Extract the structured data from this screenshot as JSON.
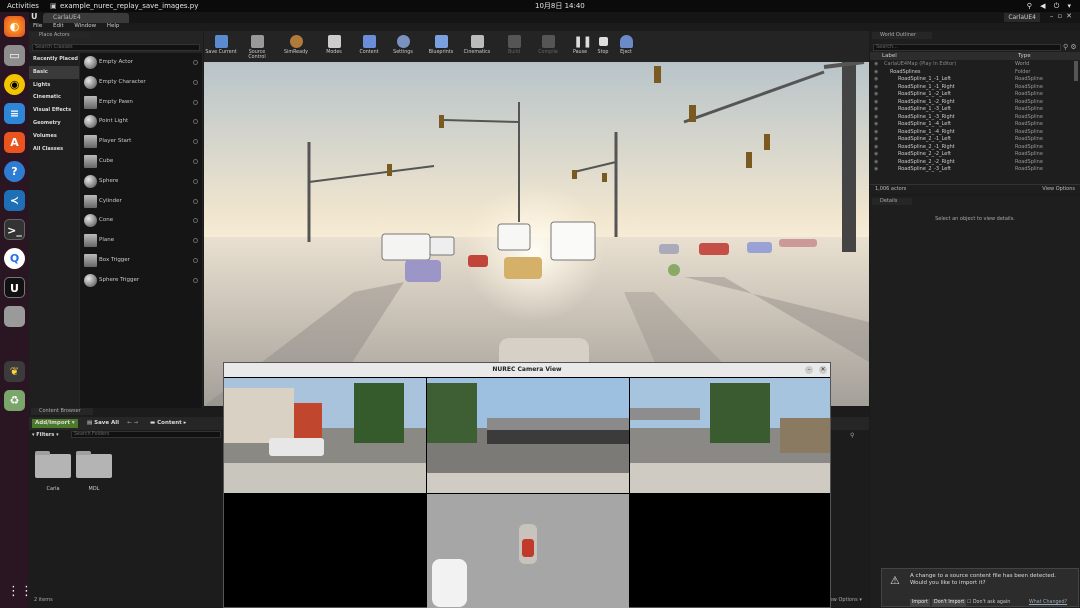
{
  "topbar": {
    "activities": "Activities",
    "app_title": "example_nurec_replay_save_images.py",
    "clock": "10月8日 14:40"
  },
  "dock": {
    "icons": [
      "firefox-icon",
      "files-icon",
      "rhythmbox-icon",
      "writer-icon",
      "software-icon",
      "help-icon",
      "vscode-icon",
      "terminal-icon",
      "qv2ray-icon",
      "unreal-icon",
      "blank-icon",
      "python-icon",
      "trash-icon"
    ],
    "apps_grid": "⋮⋮⋮"
  },
  "editor": {
    "tab_label": "CarlaUE4",
    "project": "CarlaUE4",
    "menu": [
      "File",
      "Edit",
      "Window",
      "Help"
    ],
    "modes_tab": "Place Actors",
    "search_placeholder": "Search Classes",
    "categories": [
      "Recently Placed",
      "Basic",
      "Lights",
      "Cinematic",
      "Visual Effects",
      "Geometry",
      "Volumes",
      "All Classes"
    ],
    "items": [
      "Empty Actor",
      "Empty Character",
      "Empty Pawn",
      "Point Light",
      "Player Start",
      "Cube",
      "Sphere",
      "Cylinder",
      "Cone",
      "Plane",
      "Box Trigger",
      "Sphere Trigger"
    ],
    "toolbar": [
      "Save Current",
      "Source Control",
      "SimReady",
      "Modes",
      "Content",
      "Settings",
      "Blueprints",
      "Cinematics",
      "Build",
      "Compile",
      "Pause",
      "Stop",
      "Eject"
    ]
  },
  "outliner": {
    "tab": "World Outliner",
    "search_placeholder": "Search...",
    "col_label": "Label",
    "col_type": "Type",
    "rows": [
      {
        "label": "CarlaUE4Map (Play In Editor)",
        "type": "World"
      },
      {
        "label": "RoadSplines",
        "type": "Folder"
      },
      {
        "label": "RoadSpline_1_-1_Left",
        "type": "RoadSpline"
      },
      {
        "label": "RoadSpline_1_-1_Right",
        "type": "RoadSpline"
      },
      {
        "label": "RoadSpline_1_-2_Left",
        "type": "RoadSpline"
      },
      {
        "label": "RoadSpline_1_-2_Right",
        "type": "RoadSpline"
      },
      {
        "label": "RoadSpline_1_-3_Left",
        "type": "RoadSpline"
      },
      {
        "label": "RoadSpline_1_-3_Right",
        "type": "RoadSpline"
      },
      {
        "label": "RoadSpline_1_-4_Left",
        "type": "RoadSpline"
      },
      {
        "label": "RoadSpline_1_-4_Right",
        "type": "RoadSpline"
      },
      {
        "label": "RoadSpline_2_-1_Left",
        "type": "RoadSpline"
      },
      {
        "label": "RoadSpline_2_-1_Right",
        "type": "RoadSpline"
      },
      {
        "label": "RoadSpline_2_-2_Left",
        "type": "RoadSpline"
      },
      {
        "label": "RoadSpline_2_-2_Right",
        "type": "RoadSpline"
      },
      {
        "label": "RoadSpline_2_-3_Left",
        "type": "RoadSpline"
      }
    ],
    "count": "1,006 actors",
    "view_options": "View Options"
  },
  "details": {
    "tab": "Details",
    "empty": "Select an object to view details."
  },
  "content_browser": {
    "tab": "Content Browser",
    "add_import": "Add/Import",
    "save_all": "Save All",
    "path": "Content",
    "filters": "Filters",
    "search_placeholder": "Search Folders",
    "folders": [
      "Carla",
      "MDL"
    ],
    "item_count": "2 items",
    "view_options": "View Options"
  },
  "nurec": {
    "title": "NUREC Camera View"
  },
  "toast": {
    "line1": "A change to a source content file has been detected.",
    "line2": "Would you like to import it?",
    "import": "Import",
    "dont_import": "Don't Import",
    "dont_ask": "Don't ask again",
    "what_changed": "What Changed?"
  }
}
